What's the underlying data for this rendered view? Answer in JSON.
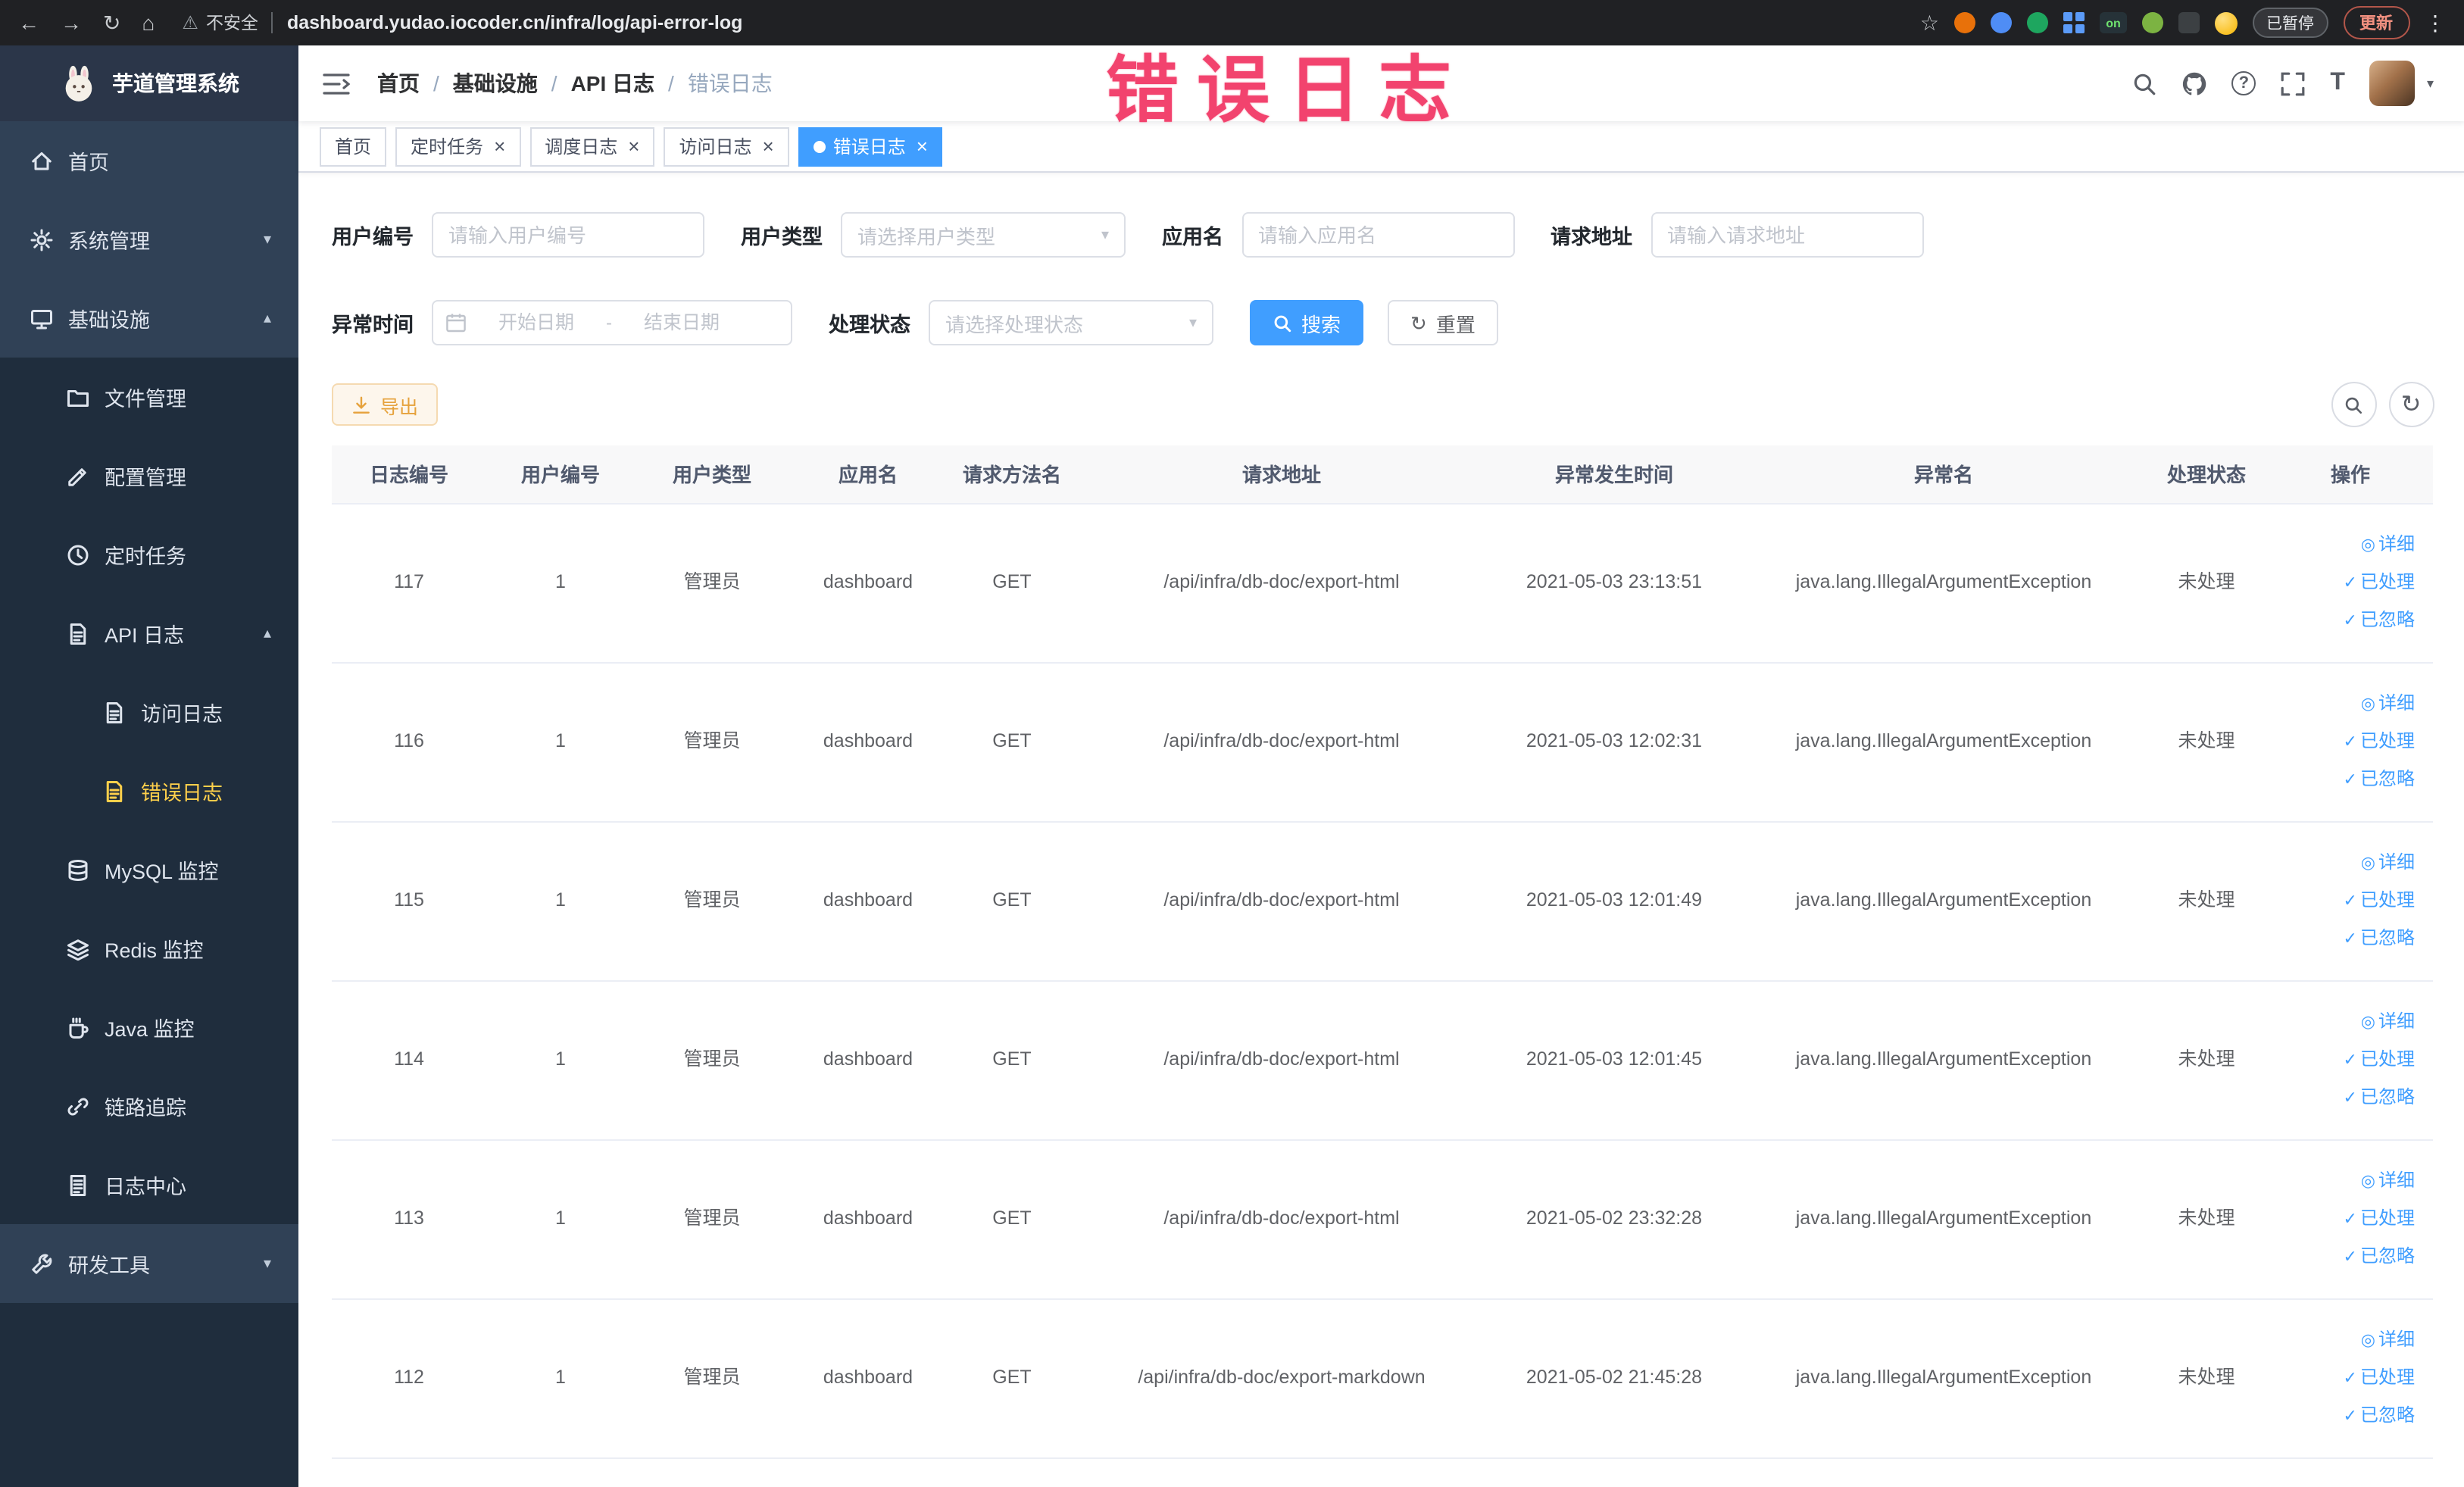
{
  "browser": {
    "security_label": "不安全",
    "url": "dashboard.yudao.iocoder.cn/infra/log/api-error-log",
    "extension_on_badge": "on",
    "paused_badge": "已暂停",
    "update_button": "更新"
  },
  "sidebar": {
    "logo_title": "芋道管理系统",
    "menu": [
      {
        "name": "home",
        "label": "首页",
        "icon": "home",
        "level": 0
      },
      {
        "name": "system-management",
        "label": "系统管理",
        "icon": "gear",
        "level": 0,
        "chevron": "down"
      },
      {
        "name": "infrastructure",
        "label": "基础设施",
        "icon": "monitor",
        "level": 0,
        "chevron": "up"
      },
      {
        "name": "file-management",
        "label": "文件管理",
        "icon": "folder",
        "level": 1,
        "sub": true
      },
      {
        "name": "config-management",
        "label": "配置管理",
        "icon": "pencil",
        "level": 1,
        "sub": true
      },
      {
        "name": "scheduled-tasks",
        "label": "定时任务",
        "icon": "clock",
        "level": 1,
        "sub": true
      },
      {
        "name": "api-log",
        "label": "API 日志",
        "icon": "doc",
        "level": 1,
        "sub": true,
        "chevron": "up"
      },
      {
        "name": "access-log",
        "label": "访问日志",
        "icon": "doc",
        "level": 2,
        "sub": true
      },
      {
        "name": "error-log",
        "label": "错误日志",
        "icon": "doc",
        "level": 2,
        "sub": true,
        "active": true
      },
      {
        "name": "mysql-monitor",
        "label": "MySQL 监控",
        "icon": "db",
        "level": 1,
        "sub": true
      },
      {
        "name": "redis-monitor",
        "label": "Redis 监控",
        "icon": "layers",
        "level": 1,
        "sub": true
      },
      {
        "name": "java-monitor",
        "label": "Java 监控",
        "icon": "coffee",
        "level": 1,
        "sub": true
      },
      {
        "name": "trace",
        "label": "链路追踪",
        "icon": "link",
        "level": 1,
        "sub": true
      },
      {
        "name": "log-center",
        "label": "日志中心",
        "icon": "filetext",
        "level": 1,
        "sub": true
      },
      {
        "name": "dev-tools",
        "label": "研发工具",
        "icon": "wrench",
        "level": 0,
        "chevron": "down"
      }
    ]
  },
  "header": {
    "breadcrumb": [
      "首页",
      "基础设施",
      "API 日志",
      "错误日志"
    ],
    "watermark": "错误日志"
  },
  "tabs": [
    {
      "name": "home",
      "label": "首页",
      "closable": false,
      "active": false
    },
    {
      "name": "scheduled-tasks",
      "label": "定时任务",
      "closable": true,
      "active": false
    },
    {
      "name": "schedule-log",
      "label": "调度日志",
      "closable": true,
      "active": false
    },
    {
      "name": "access-log",
      "label": "访问日志",
      "closable": true,
      "active": false
    },
    {
      "name": "error-log",
      "label": "错误日志",
      "closable": true,
      "active": true
    }
  ],
  "filters": {
    "user_id": {
      "label": "用户编号",
      "placeholder": "请输入用户编号"
    },
    "user_type": {
      "label": "用户类型",
      "placeholder": "请选择用户类型"
    },
    "app_name": {
      "label": "应用名",
      "placeholder": "请输入应用名"
    },
    "request_url": {
      "label": "请求地址",
      "placeholder": "请输入请求地址"
    },
    "exception_time": {
      "label": "异常时间",
      "start_placeholder": "开始日期",
      "separator": "-",
      "end_placeholder": "结束日期"
    },
    "process_status": {
      "label": "处理状态",
      "placeholder": "请选择处理状态"
    },
    "search_button": "搜索",
    "reset_button": "重置"
  },
  "toolbar": {
    "export_button": "导出"
  },
  "table": {
    "columns": [
      "日志编号",
      "用户编号",
      "用户类型",
      "应用名",
      "请求方法名",
      "请求地址",
      "异常发生时间",
      "异常名",
      "处理状态",
      "操作"
    ],
    "rows": [
      {
        "id": "117",
        "user_id": "1",
        "user_type": "管理员",
        "app": "dashboard",
        "method": "GET",
        "url": "/api/infra/db-doc/export-html",
        "time": "2021-05-03 23:13:51",
        "exception": "java.lang.IllegalArgumentException",
        "status": "未处理"
      },
      {
        "id": "116",
        "user_id": "1",
        "user_type": "管理员",
        "app": "dashboard",
        "method": "GET",
        "url": "/api/infra/db-doc/export-html",
        "time": "2021-05-03 12:02:31",
        "exception": "java.lang.IllegalArgumentException",
        "status": "未处理"
      },
      {
        "id": "115",
        "user_id": "1",
        "user_type": "管理员",
        "app": "dashboard",
        "method": "GET",
        "url": "/api/infra/db-doc/export-html",
        "time": "2021-05-03 12:01:49",
        "exception": "java.lang.IllegalArgumentException",
        "status": "未处理"
      },
      {
        "id": "114",
        "user_id": "1",
        "user_type": "管理员",
        "app": "dashboard",
        "method": "GET",
        "url": "/api/infra/db-doc/export-html",
        "time": "2021-05-03 12:01:45",
        "exception": "java.lang.IllegalArgumentException",
        "status": "未处理"
      },
      {
        "id": "113",
        "user_id": "1",
        "user_type": "管理员",
        "app": "dashboard",
        "method": "GET",
        "url": "/api/infra/db-doc/export-html",
        "time": "2021-05-02 23:32:28",
        "exception": "java.lang.IllegalArgumentException",
        "status": "未处理"
      },
      {
        "id": "112",
        "user_id": "1",
        "user_type": "管理员",
        "app": "dashboard",
        "method": "GET",
        "url": "/api/infra/db-doc/export-markdown",
        "time": "2021-05-02 21:45:28",
        "exception": "java.lang.IllegalArgumentException",
        "status": "未处理"
      }
    ],
    "row_actions": [
      {
        "name": "detail",
        "label": "详细",
        "icon": "view"
      },
      {
        "name": "processed",
        "label": "已处理",
        "icon": "check"
      },
      {
        "name": "ignored",
        "label": "已忽略",
        "icon": "check"
      }
    ]
  },
  "colors": {
    "accent": "#409EFF",
    "menu-active": "#ffd04b",
    "warning": "#e6a23c",
    "watermark": "#f2436e",
    "sidebar-bg": "#304156",
    "submenu-bg": "#1f2d3d",
    "tab-active-bg": "#409EFF"
  }
}
